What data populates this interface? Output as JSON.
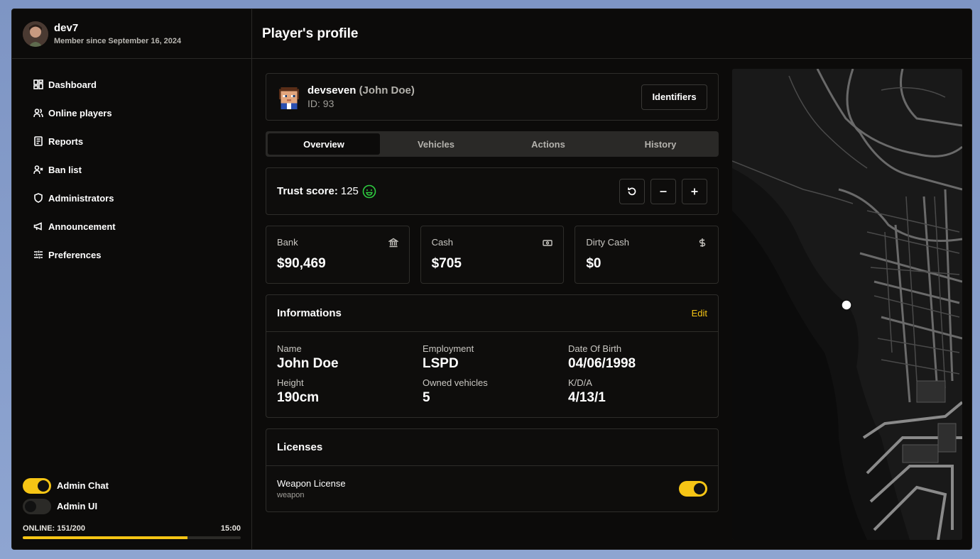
{
  "user": {
    "name": "dev7",
    "member_since": "Member since September 16, 2024"
  },
  "sidebar": {
    "items": [
      {
        "label": "Dashboard",
        "icon": "dashboard-icon"
      },
      {
        "label": "Online players",
        "icon": "users-icon"
      },
      {
        "label": "Reports",
        "icon": "reports-icon"
      },
      {
        "label": "Ban list",
        "icon": "user-x-icon"
      },
      {
        "label": "Administrators",
        "icon": "shield-icon"
      },
      {
        "label": "Announcement",
        "icon": "megaphone-icon"
      },
      {
        "label": "Preferences",
        "icon": "sliders-icon"
      }
    ],
    "toggles": [
      {
        "label": "Admin Chat",
        "on": true
      },
      {
        "label": "Admin UI",
        "on": false
      }
    ],
    "online_label": "ONLINE: 151/200",
    "online_fraction": 0.755,
    "time": "15:00"
  },
  "header": {
    "title": "Player's profile"
  },
  "player": {
    "username": "devseven",
    "real_name": "(John Doe)",
    "id_text": "ID: 93",
    "identifiers_button": "Identifiers"
  },
  "tabs": [
    {
      "label": "Overview",
      "active": true
    },
    {
      "label": "Vehicles",
      "active": false
    },
    {
      "label": "Actions",
      "active": false
    },
    {
      "label": "History",
      "active": false
    }
  ],
  "trust": {
    "label": "Trust score:",
    "value": "125",
    "icon": "smile-icon"
  },
  "money": [
    {
      "label": "Bank",
      "value": "$90,469",
      "icon": "bank-icon"
    },
    {
      "label": "Cash",
      "value": "$705",
      "icon": "banknote-icon"
    },
    {
      "label": "Dirty Cash",
      "value": "$0",
      "icon": "dollar-icon"
    }
  ],
  "info": {
    "title": "Informations",
    "edit_label": "Edit",
    "fields": [
      {
        "label": "Name",
        "value": "John Doe"
      },
      {
        "label": "Employment",
        "value": "LSPD"
      },
      {
        "label": "Date Of Birth",
        "value": "04/06/1998"
      },
      {
        "label": "Height",
        "value": "190cm"
      },
      {
        "label": "Owned vehicles",
        "value": "5"
      },
      {
        "label": "K/D/A",
        "value": "4/13/1"
      }
    ]
  },
  "licenses": {
    "title": "Licenses",
    "items": [
      {
        "name": "Weapon License",
        "type": "weapon",
        "enabled": true
      }
    ]
  },
  "colors": {
    "accent": "#f6c515",
    "background": "#0c0b0a",
    "border": "#2e2d2a",
    "trust_green": "#2ecc40"
  }
}
